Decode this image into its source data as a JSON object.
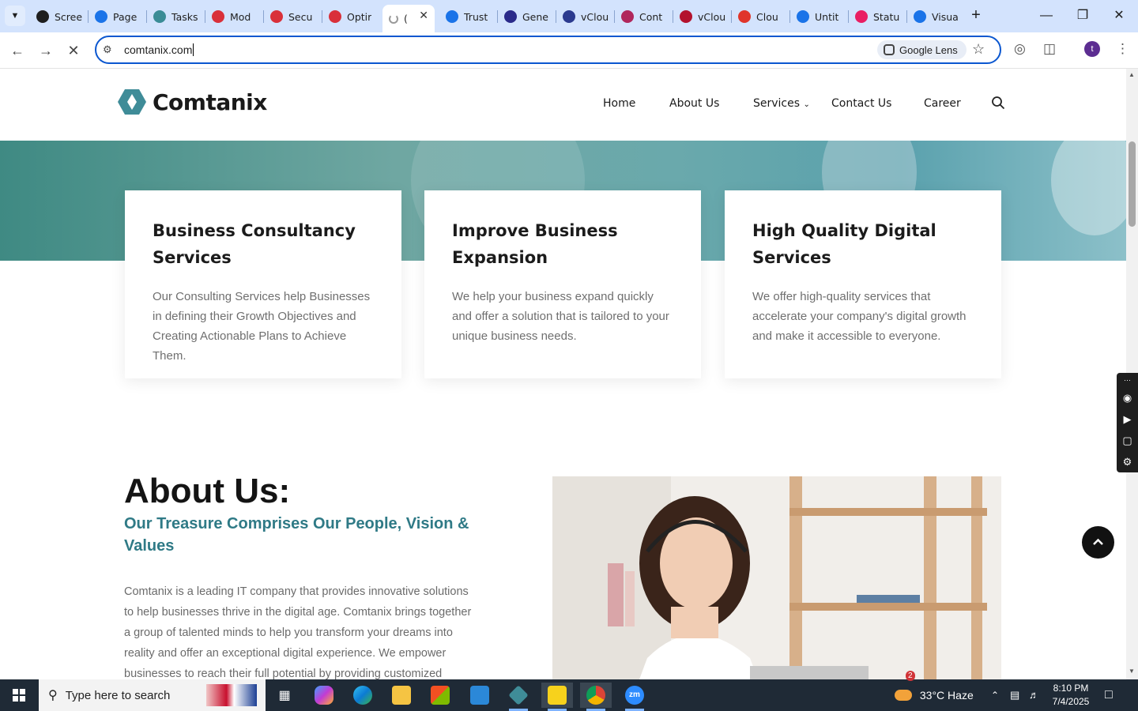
{
  "browser": {
    "tabs": [
      {
        "title": "Scree",
        "icon": "screencast-icon",
        "color": "#1f1f1f"
      },
      {
        "title": "Page",
        "icon": "gauge-icon",
        "color": "#1a73e8"
      },
      {
        "title": "Tasks",
        "icon": "comtanix-icon",
        "color": "#3a8c96"
      },
      {
        "title": "Mod",
        "icon": "shield-red-icon",
        "color": "#d9303a"
      },
      {
        "title": "Secu",
        "icon": "shield-red-icon",
        "color": "#d9303a"
      },
      {
        "title": "Optir",
        "icon": "shield-red-icon",
        "color": "#d9303a"
      },
      {
        "title": "(",
        "icon": "loading-icon",
        "color": "#555555",
        "active": true
      },
      {
        "title": "Trust",
        "icon": "scales-icon",
        "color": "#1a73e8"
      },
      {
        "title": "Gene",
        "icon": "x-icon",
        "color": "#2a2a8a"
      },
      {
        "title": "vClou",
        "icon": "check-icon",
        "color": "#2b3a8f"
      },
      {
        "title": "Cont",
        "icon": "cont-icon",
        "color": "#b0275c"
      },
      {
        "title": "vClou",
        "icon": "v-icon",
        "color": "#b3122e"
      },
      {
        "title": "Clou",
        "icon": "cloud-red-icon",
        "color": "#e0352b"
      },
      {
        "title": "Untit",
        "icon": "doc-icon",
        "color": "#1a73e8"
      },
      {
        "title": "Statu",
        "icon": "star-icon",
        "color": "#e91e63"
      },
      {
        "title": "Visua",
        "icon": "pulse-icon",
        "color": "#1a73e8"
      }
    ],
    "url": "comtanix.com",
    "lens_label": "Google Lens",
    "profile_initial": "t"
  },
  "site": {
    "brand": "Comtanix",
    "nav": [
      "Home",
      "About Us",
      "Services",
      "Contact Us",
      "Career"
    ],
    "cards": [
      {
        "title": "Business Consultancy Services",
        "text": "Our Consulting Services help Businesses in defining their Growth Objectives and Creating Actionable Plans to Achieve Them."
      },
      {
        "title": "Improve Business Expansion",
        "text": "We help your business expand quickly and offer a solution that is tailored to your unique business needs."
      },
      {
        "title": "High Quality Digital Services",
        "text": "We offer high-quality services that accelerate your company's digital growth and make it accessible to everyone."
      }
    ],
    "about": {
      "heading": "About Us:",
      "subheading": "Our Treasure Comprises Our People, Vision & Values",
      "body": "Comtanix is a leading  IT company that provides innovative solutions to help businesses thrive in the digital age. Comtanix brings together a group of talented minds to help you transform your dreams into reality and offer an exceptional digital experience. We empower businesses to reach their full potential by providing customized solutions and"
    },
    "accent_color": "#2f7a86"
  },
  "taskbar": {
    "search_placeholder": "Type here to search",
    "weather_badge": "2",
    "weather": "33°C  Haze",
    "time": "8:10 PM",
    "date": "7/4/2025"
  }
}
